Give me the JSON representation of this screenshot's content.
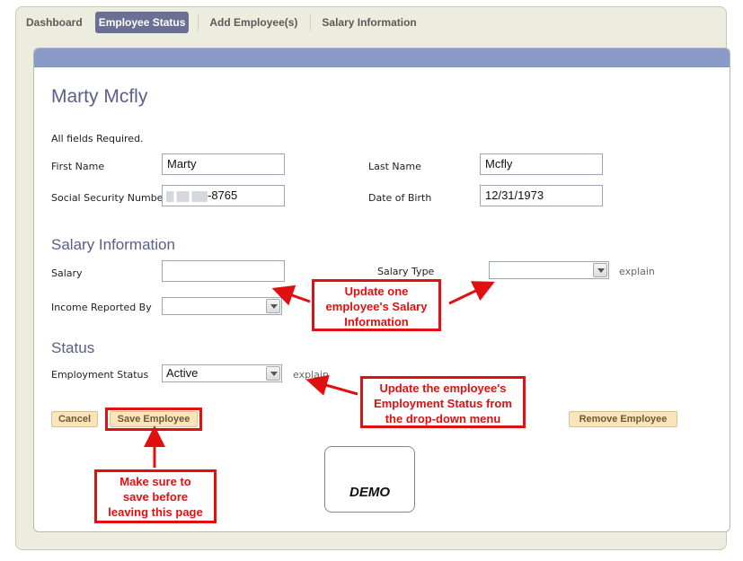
{
  "tabs": [
    {
      "label": "Dashboard",
      "active": false
    },
    {
      "label": "Employee Status",
      "active": true
    },
    {
      "label": "Add Employee(s)",
      "active": false
    },
    {
      "label": "Salary Information",
      "active": false
    }
  ],
  "employee_name": "Marty Mcfly",
  "required_note": "All fields Required.",
  "fields": {
    "first_name": {
      "label": "First Name",
      "value": "Marty"
    },
    "last_name": {
      "label": "Last Name",
      "value": "Mcfly"
    },
    "ssn": {
      "label": "Social Security Number",
      "value": "-8765"
    },
    "dob": {
      "label": "Date of Birth",
      "value": "12/31/1973"
    }
  },
  "salary_section": {
    "title": "Salary Information",
    "salary_label": "Salary",
    "salary_value": "",
    "salary_type_label": "Salary Type",
    "salary_type_value": "",
    "income_reported_label": "Income Reported By",
    "income_reported_value": "",
    "explain": "explain"
  },
  "status_section": {
    "title": "Status",
    "employment_status_label": "Employment Status",
    "employment_status_value": "Active",
    "explain": "explain"
  },
  "buttons": {
    "cancel": "Cancel",
    "save": "Save Employee",
    "remove": "Remove Employee"
  },
  "callouts": {
    "salary": "Update one\nemployee's Salary\nInformation",
    "status": "Update the employee's\nEmployment Status from\nthe drop-down menu",
    "save": "Make sure to\nsave before\nleaving this page"
  },
  "demo_label": "DEMO",
  "colors": {
    "accent_header": "#8b9bc7",
    "active_tab": "#6a6f94",
    "heading": "#5a5f88",
    "button": "#fbe5b8",
    "callout": "#e01010"
  }
}
